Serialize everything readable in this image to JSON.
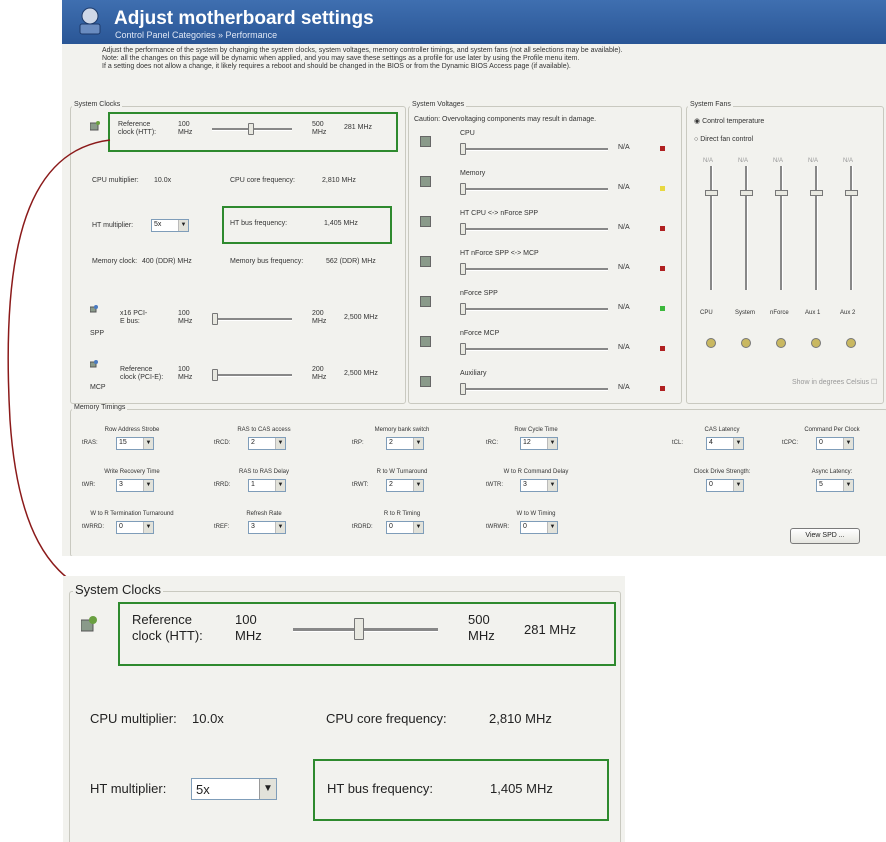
{
  "header": {
    "title": "Adjust motherboard settings",
    "subtitle": "Control Panel Categories » Performance",
    "description": [
      "Adjust the performance of the system by changing the system clocks, system voltages, memory controller timings, and system fans (not all selections may be available).",
      "Note: all the changes on this page will be dynamic when applied, and you may save these settings as a profile for use later by using the Profile menu item.",
      "If a setting does not allow a change, it likely requires a reboot and should be changed in the BIOS or from the Dynamic BIOS Access page (if available)."
    ]
  },
  "clocks": {
    "title": "System Clocks",
    "ref_label": "Reference clock (HTT):",
    "ref_min": "100 MHz",
    "ref_max": "500 MHz",
    "ref_value": "281 MHz",
    "ref_fraction": 0.45,
    "cpu_mult_label": "CPU multiplier:",
    "cpu_mult_value": "10.0x",
    "cpu_core_label": "CPU core frequency:",
    "cpu_core_value": "2,810 MHz",
    "ht_mult_label": "HT multiplier:",
    "ht_mult_value": "5x",
    "ht_bus_label": "HT bus frequency:",
    "ht_bus_value": "1,405 MHz",
    "mem_clock_label": "Memory clock:",
    "mem_clock_value": "400 (DDR) MHz",
    "mem_bus_label": "Memory bus frequency:",
    "mem_bus_value": "562 (DDR) MHz",
    "pcie_label": "x16 PCI-E bus:",
    "pcie_min": "100 MHz",
    "pcie_max": "200 MHz",
    "pcie_value": "2,500 MHz",
    "spp_label": "SPP",
    "mcp_ref_label": "Reference clock (PCI-E):",
    "mcp_min": "100 MHz",
    "mcp_max": "200 MHz",
    "mcp_value": "2,500 MHz",
    "mcp_label": "MCP"
  },
  "voltages": {
    "title": "System Voltages",
    "caution": "Caution: Overvoltaging components may result in damage.",
    "items": [
      {
        "name": "CPU",
        "value": "N/A",
        "status": "#b02020"
      },
      {
        "name": "Memory",
        "value": "N/A",
        "status": "#e8d840"
      },
      {
        "name": "HT CPU <-> nForce SPP",
        "value": "N/A",
        "status": "#b02020"
      },
      {
        "name": "HT nForce SPP <-> MCP",
        "value": "N/A",
        "status": "#b02020"
      },
      {
        "name": "nForce SPP",
        "value": "N/A",
        "status": "#3cb83c"
      },
      {
        "name": "nForce MCP",
        "value": "N/A",
        "status": "#b02020"
      },
      {
        "name": "Auxiliary",
        "value": "N/A",
        "status": "#b02020"
      }
    ]
  },
  "fans": {
    "title": "System Fans",
    "opt_control": "Control temperature",
    "opt_direct": "Direct fan control",
    "values": [
      "N/A",
      "N/A",
      "N/A",
      "N/A",
      "N/A"
    ],
    "names": [
      "CPU",
      "System",
      "nForce",
      "Aux 1",
      "Aux 2"
    ],
    "show_celsius": "Show in degrees Celsius"
  },
  "memory": {
    "title": "Memory Timings",
    "rows": [
      [
        {
          "head": "Row Address Strobe",
          "abbr": "tRAS:",
          "value": "15"
        },
        {
          "head": "RAS to CAS access",
          "abbr": "tRCD:",
          "value": "2"
        },
        {
          "head": "Memory bank switch",
          "abbr": "tRP:",
          "value": "2"
        },
        {
          "head": "Row Cycle Time",
          "abbr": "tRC:",
          "value": "12"
        },
        {
          "head": "CAS Latency",
          "abbr": "tCL:",
          "value": "4"
        },
        {
          "head": "Command Per Clock",
          "abbr": "tCPC:",
          "value": "0"
        }
      ],
      [
        {
          "head": "Write Recovery Time",
          "abbr": "tWR:",
          "value": "3"
        },
        {
          "head": "RAS to RAS Delay",
          "abbr": "tRRD:",
          "value": "1"
        },
        {
          "head": "R to W Turnaround",
          "abbr": "tRWT:",
          "value": "2"
        },
        {
          "head": "W to R Command Delay",
          "abbr": "tWTR:",
          "value": "3"
        },
        {
          "head": "Clock Drive Strength:",
          "abbr": "",
          "value": "0"
        },
        {
          "head": "Async Latency:",
          "abbr": "",
          "value": "5"
        }
      ],
      [
        {
          "head": "W to R Termination Turnaround",
          "abbr": "tWRRD:",
          "value": "0"
        },
        {
          "head": "Refresh Rate",
          "abbr": "tREF:",
          "value": "3"
        },
        {
          "head": "R to R Timing",
          "abbr": "tRDRD:",
          "value": "0"
        },
        {
          "head": "W to W Timing",
          "abbr": "tWRWR:",
          "value": "0"
        }
      ]
    ],
    "view_spd": "View SPD ..."
  },
  "colors": {
    "highlight": "#2e8a2e",
    "arrow": "#8b1a1a",
    "header": "#3f6fb0"
  }
}
